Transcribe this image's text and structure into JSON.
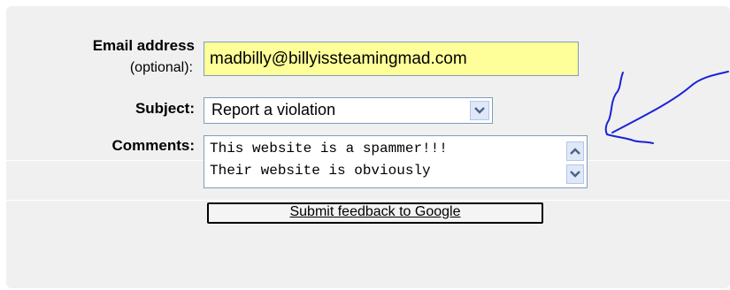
{
  "form": {
    "email_label": "Email address",
    "email_sublabel": "(optional):",
    "email_value": "madbilly@billyissteamingmad.com",
    "subject_label": "Subject:",
    "subject_value": "Report a violation",
    "comments_label": "Comments:",
    "comments_lines": [
      "This website is a spammer!!!",
      "Their website is obviously"
    ],
    "submit_label": "Submit feedback to Google"
  },
  "icons": {
    "dropdown": "chevron-down-icon",
    "scroll_up": "arrow-up-icon",
    "scroll_down": "arrow-down-icon",
    "annotation": "hand-drawn-arrow"
  },
  "colors": {
    "email_background": "#ffff99",
    "annotation_ink": "#1a22d8",
    "panel_background": "#f0f0f0"
  }
}
